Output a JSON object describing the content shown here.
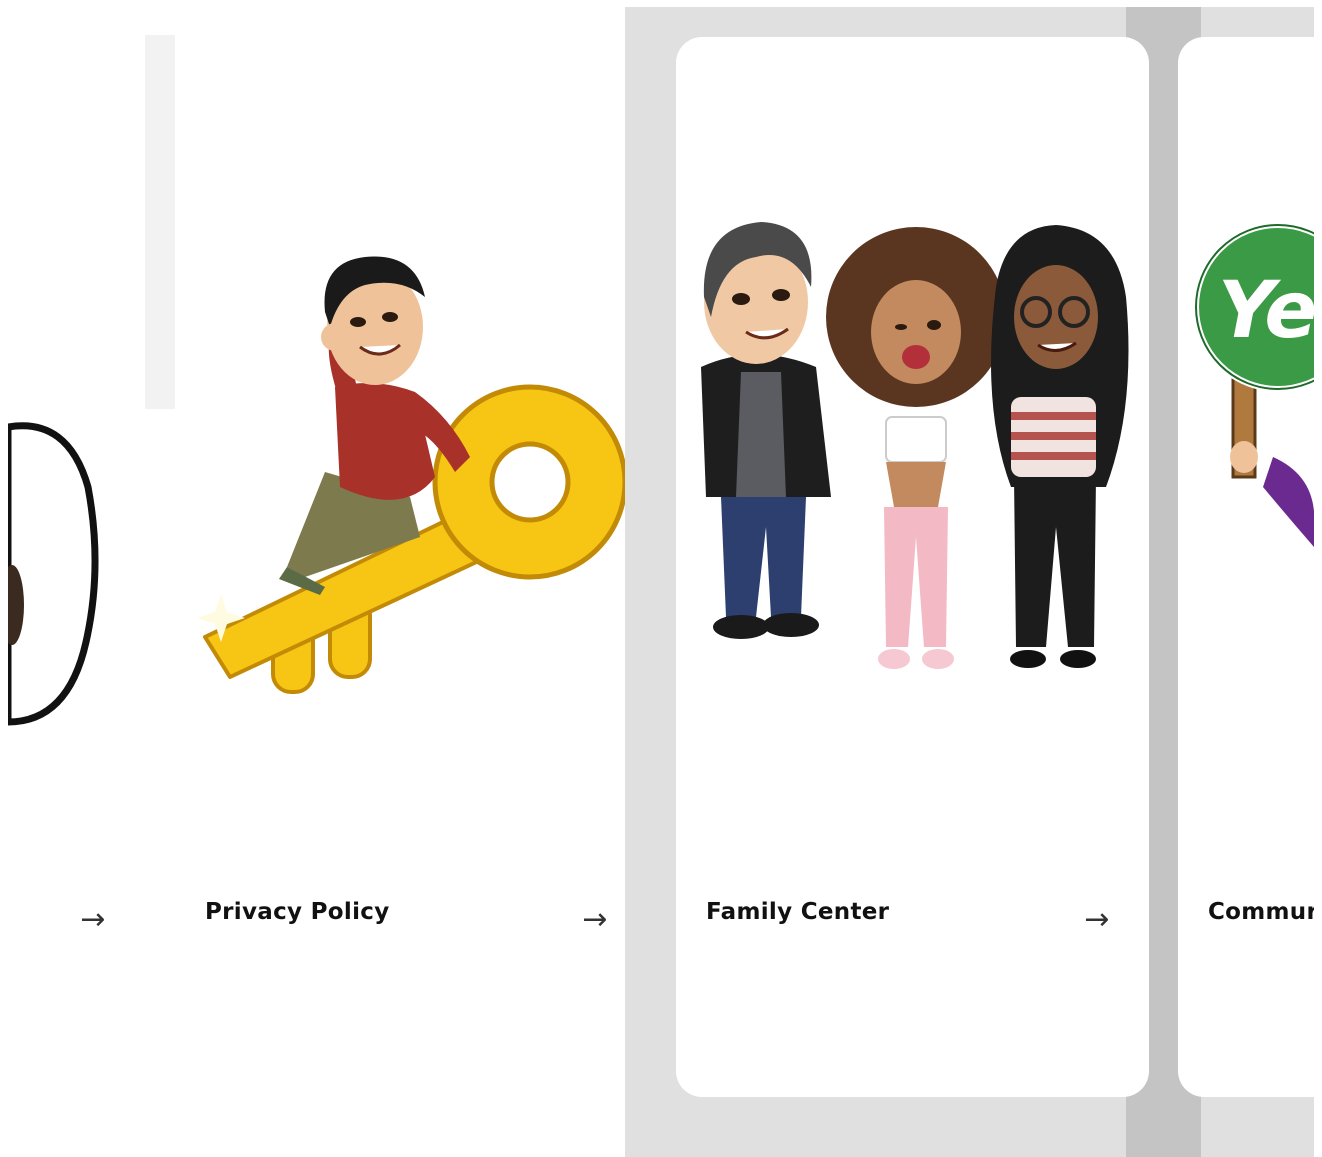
{
  "cards": [
    {
      "title": "",
      "arrow": "→"
    },
    {
      "title": "Privacy Policy",
      "arrow": "→"
    },
    {
      "title": "Family Center",
      "arrow": "→"
    },
    {
      "title": "Commur"
    }
  ],
  "colors": {
    "panel": "#e0e0e0",
    "scroll_strip": "#c4c4c4",
    "card": "#ffffff",
    "key_gold": "#f7c513",
    "sign_green": "#3a9a46"
  },
  "illustrations": {
    "left": "partial-avatar-icon",
    "privacy": "key-avatar-icon",
    "family": "family-avatars-icon",
    "community": "yes-sign-icon"
  },
  "sign_text": "Yes"
}
